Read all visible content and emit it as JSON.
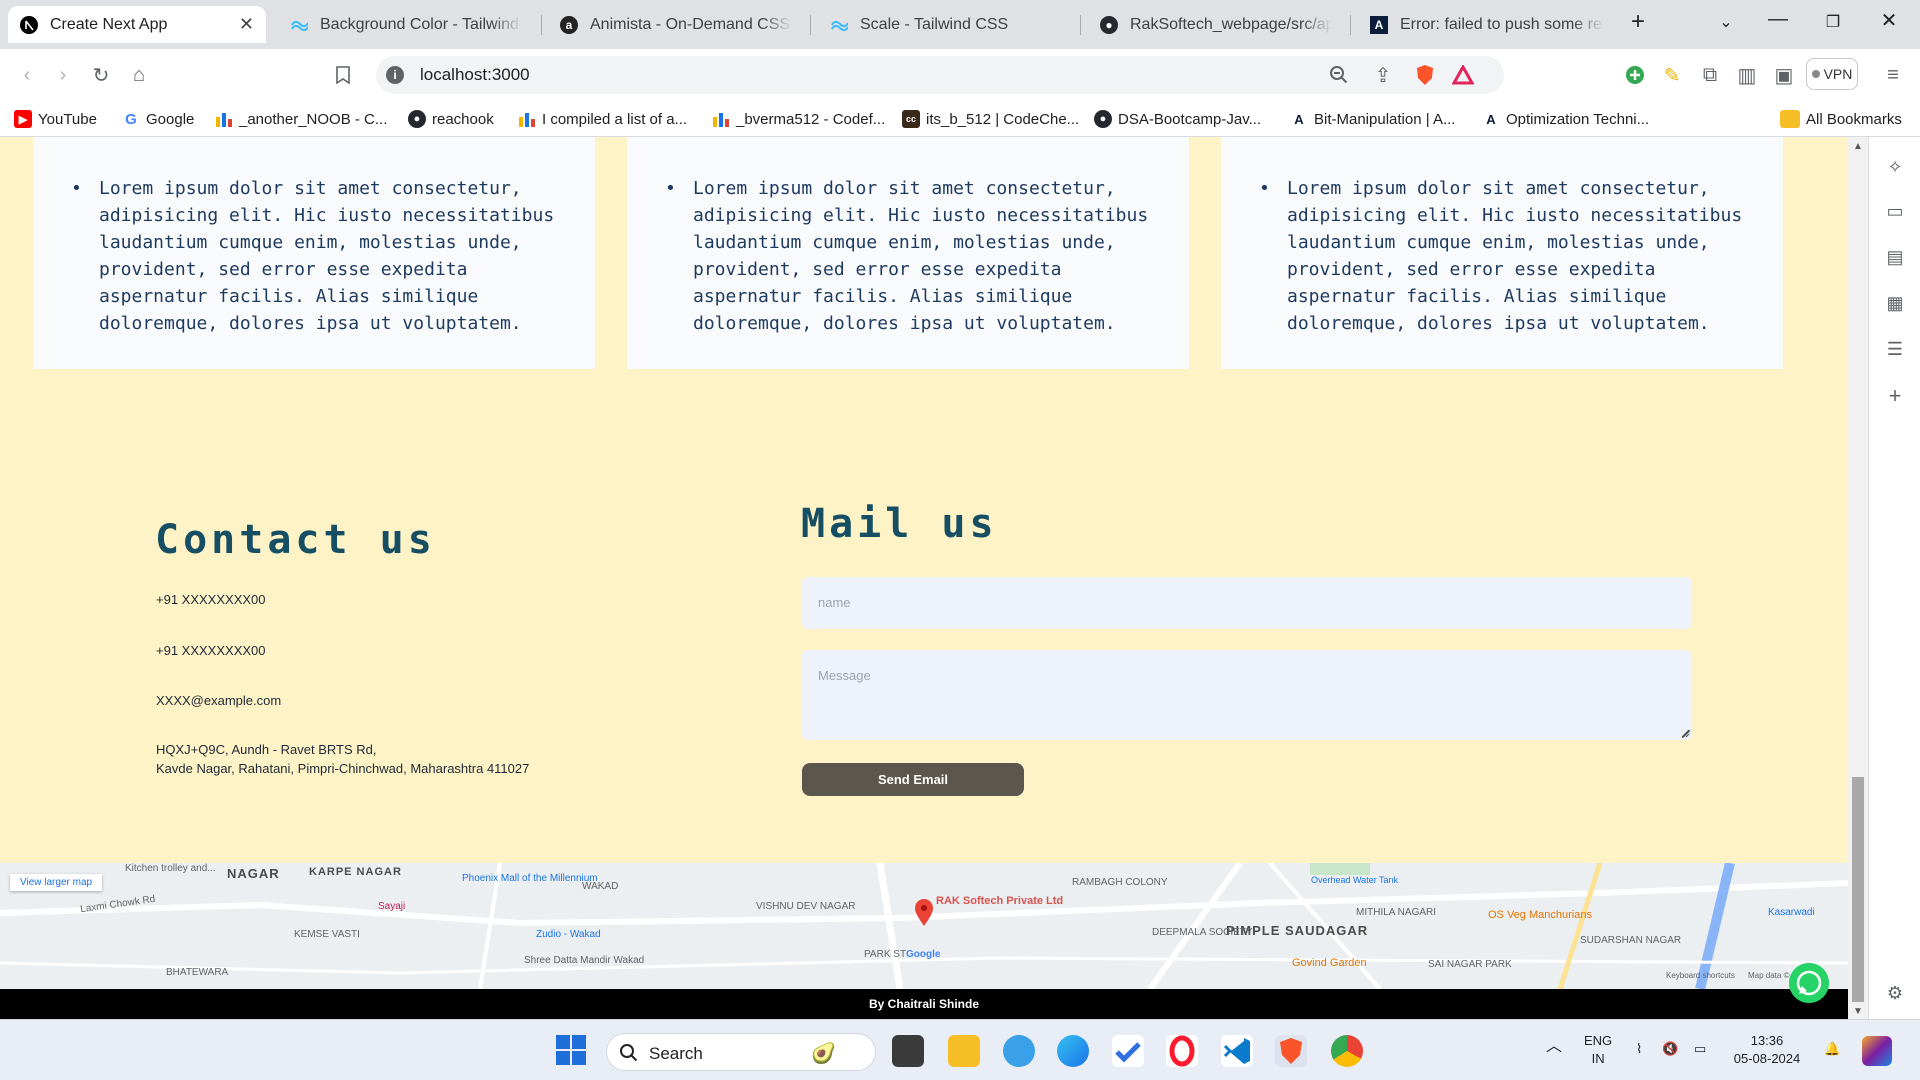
{
  "browser": {
    "tabs": [
      {
        "title": "Create Next App",
        "active": true
      },
      {
        "title": "Background Color - Tailwind CSS"
      },
      {
        "title": "Animista - On-Demand CSS Animations"
      },
      {
        "title": "Scale - Tailwind CSS"
      },
      {
        "title": "RakSoftech_webpage/src/app at main"
      },
      {
        "title": "Error: failed to push some refs to"
      }
    ],
    "url": "localhost:3000",
    "vpn_label": "VPN",
    "bookmarks": [
      "YouTube",
      "Google",
      "_another_NOOB - C...",
      "reachook",
      "I compiled a list of a...",
      "_bverma512 - Codef...",
      "its_b_512 | CodeChe...",
      "DSA-Bootcamp-Jav...",
      "Bit-Manipulation | A...",
      "Optimization Techni..."
    ],
    "all_bookmarks": "All Bookmarks"
  },
  "cards": [
    {
      "text": "Lorem ipsum dolor sit amet consectetur, adipisicing elit. Hic iusto necessitatibus laudantium cumque enim, molestias unde, provident, sed error esse expedita aspernatur facilis. Alias similique doloremque, dolores ipsa ut voluptatem."
    },
    {
      "text": "Lorem ipsum dolor sit amet consectetur, adipisicing elit. Hic iusto necessitatibus laudantium cumque enim, molestias unde, provident, sed error esse expedita aspernatur facilis. Alias similique doloremque, dolores ipsa ut voluptatem."
    },
    {
      "text": "Lorem ipsum dolor sit amet consectetur, adipisicing elit. Hic iusto necessitatibus laudantium cumque enim, molestias unde, provident, sed error esse expedita aspernatur facilis. Alias similique doloremque, dolores ipsa ut voluptatem."
    }
  ],
  "contact": {
    "title": "Contact us",
    "phone1": "+91 XXXXXXXX00",
    "phone2": "+91 XXXXXXXX00",
    "email": "XXXX@example.com",
    "address_line1": "HQXJ+Q9C, Aundh - Ravet BRTS Rd,",
    "address_line2": "Kavde Nagar, Rahatani, Pimpri-Chinchwad, Maharashtra 411027"
  },
  "mail": {
    "title": "Mail us",
    "name_placeholder": "name",
    "message_placeholder": "Message",
    "send_label": "Send Email"
  },
  "map": {
    "view_larger": "View larger map",
    "marker_label": "RAK Softech Private Ltd",
    "labels": {
      "nagar": "NAGAR",
      "karpe": "KARPE NAGAR",
      "phoenix": "Phoenix Mall of the Millennium",
      "wakad": "WAKAD",
      "vishnu": "VISHNU DEV NAGAR",
      "rambagh": "RAMBAGH COLONY",
      "pimple": "PIMPLE SAUDAGAR",
      "mithila": "MITHILA NAGARI",
      "os_veg": "OS Veg Manchurians",
      "kasarwadi": "Kasarwadi",
      "zudio": "Zudio - Wakad",
      "sayaji": "Sayaji",
      "kemse": "KEMSE VASTI",
      "deepmala": "DEEPMALA SOCIETY",
      "govind": "Govind Garden",
      "sai_nagar": "SAI NAGAR PARK",
      "sudarshan": "SUDARSHAN NAGAR",
      "shree_datta": "Shree Datta Mandir Wakad",
      "park_st": "PARK ST",
      "bhatewara": "BHATEWARA",
      "laxmi": "Laxmi Chowk Rd",
      "kitchen": "Kitchen trolley and...",
      "google": "Google",
      "shortcuts": "Keyboard shortcuts",
      "mapdata": "Map data ©",
      "overhead": "Overhead Water Tank"
    }
  },
  "footer": {
    "text": "By Chaitrali Shinde"
  },
  "taskbar": {
    "search_label": "Search",
    "lang1": "ENG",
    "lang2": "IN",
    "time": "13:36",
    "date": "05-08-2024"
  },
  "colors": {
    "page_bg": "#fef3c7",
    "card_bg": "#f8fafc",
    "heading": "#164e63",
    "button": "#5b574f",
    "footer": "#000000"
  }
}
